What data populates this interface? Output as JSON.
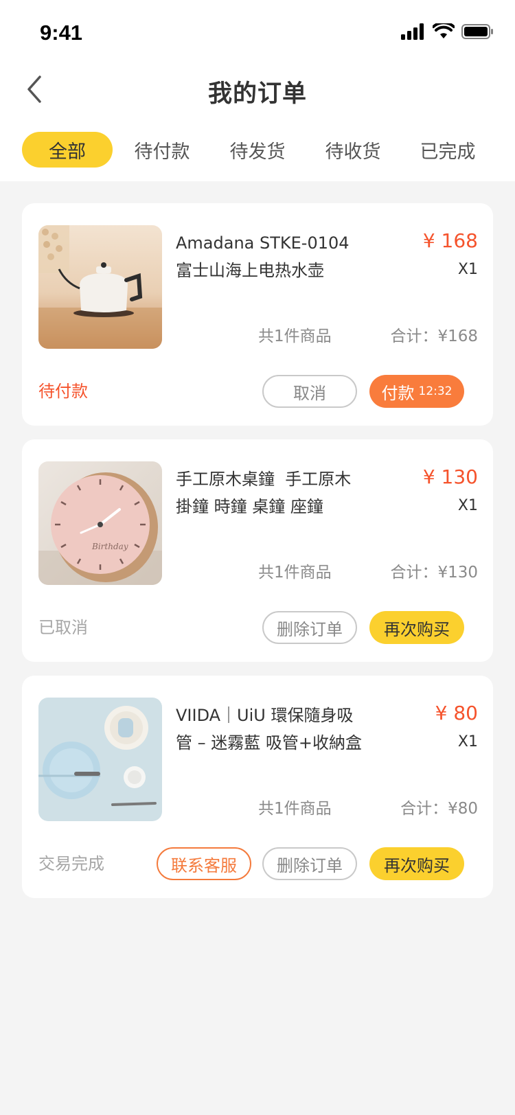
{
  "status_bar": {
    "time": "9:41"
  },
  "nav": {
    "title": "我的订单"
  },
  "tabs": [
    {
      "label": "全部",
      "active": true
    },
    {
      "label": "待付款",
      "active": false
    },
    {
      "label": "待发货",
      "active": false
    },
    {
      "label": "待收货",
      "active": false
    },
    {
      "label": "已完成",
      "active": false
    }
  ],
  "orders": [
    {
      "title_line1": "Amadana STKE-0104",
      "title_line2": "富士山海上电热水壶",
      "price": "¥ 168",
      "qty": "X1",
      "count": "共1件商品",
      "total": "合计：¥168",
      "status": "待付款",
      "buttons": {
        "cancel": "取消",
        "pay": "付款",
        "pay_timer": "12:32"
      }
    },
    {
      "title_line1": "手工原木桌鐘  手工原木",
      "title_line2": "掛鐘 時鐘 桌鐘 座鐘",
      "price": "¥ 130",
      "qty": "X1",
      "count": "共1件商品",
      "total": "合计：¥130",
      "status": "已取消",
      "buttons": {
        "delete": "删除订单",
        "rebuy": "再次购买"
      }
    },
    {
      "title_line1": "VIIDA｜UiU 環保隨身吸",
      "title_line2": "管 – 迷霧藍 吸管+收納盒",
      "price": "¥ 80",
      "qty": "X1",
      "count": "共1件商品",
      "total": "合计：¥80",
      "status": "交易完成",
      "buttons": {
        "contact": "联系客服",
        "delete": "删除订单",
        "rebuy": "再次购买"
      }
    }
  ],
  "colors": {
    "accent_yellow": "#fbd02e",
    "price_red": "#f5532c",
    "pay_orange": "#f97c3c",
    "pending_status": "#f5532c",
    "muted_status": "#a6a6a6"
  },
  "icons": [
    "signal-icon",
    "wifi-icon",
    "battery-icon",
    "back-arrow-icon"
  ]
}
